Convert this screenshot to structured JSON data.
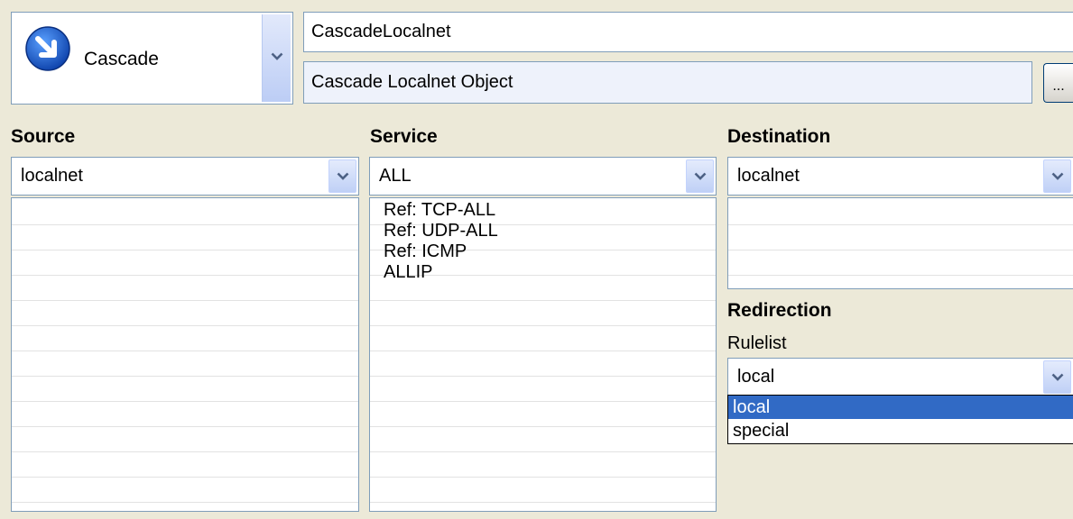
{
  "action": {
    "label": "Cascade",
    "icon": "cascade-arrow-icon",
    "accent": "#1e5fc6"
  },
  "rule": {
    "name": "CascadeLocalnet",
    "comment": "Cascade Localnet Object",
    "more_label": "..."
  },
  "source": {
    "header": "Source",
    "selected": "localnet",
    "items": []
  },
  "service": {
    "header": "Service",
    "selected": "ALL",
    "items": [
      "Ref: TCP-ALL",
      "Ref: UDP-ALL",
      "Ref: ICMP",
      "ALLIP"
    ]
  },
  "destination": {
    "header": "Destination",
    "selected": "localnet",
    "items": []
  },
  "redirection": {
    "header": "Redirection",
    "rulelist_label": "Rulelist",
    "selected": "local",
    "options": [
      {
        "label": "local",
        "highlighted": true
      },
      {
        "label": "special",
        "highlighted": false
      }
    ],
    "highlight_color": "#316ac5"
  }
}
